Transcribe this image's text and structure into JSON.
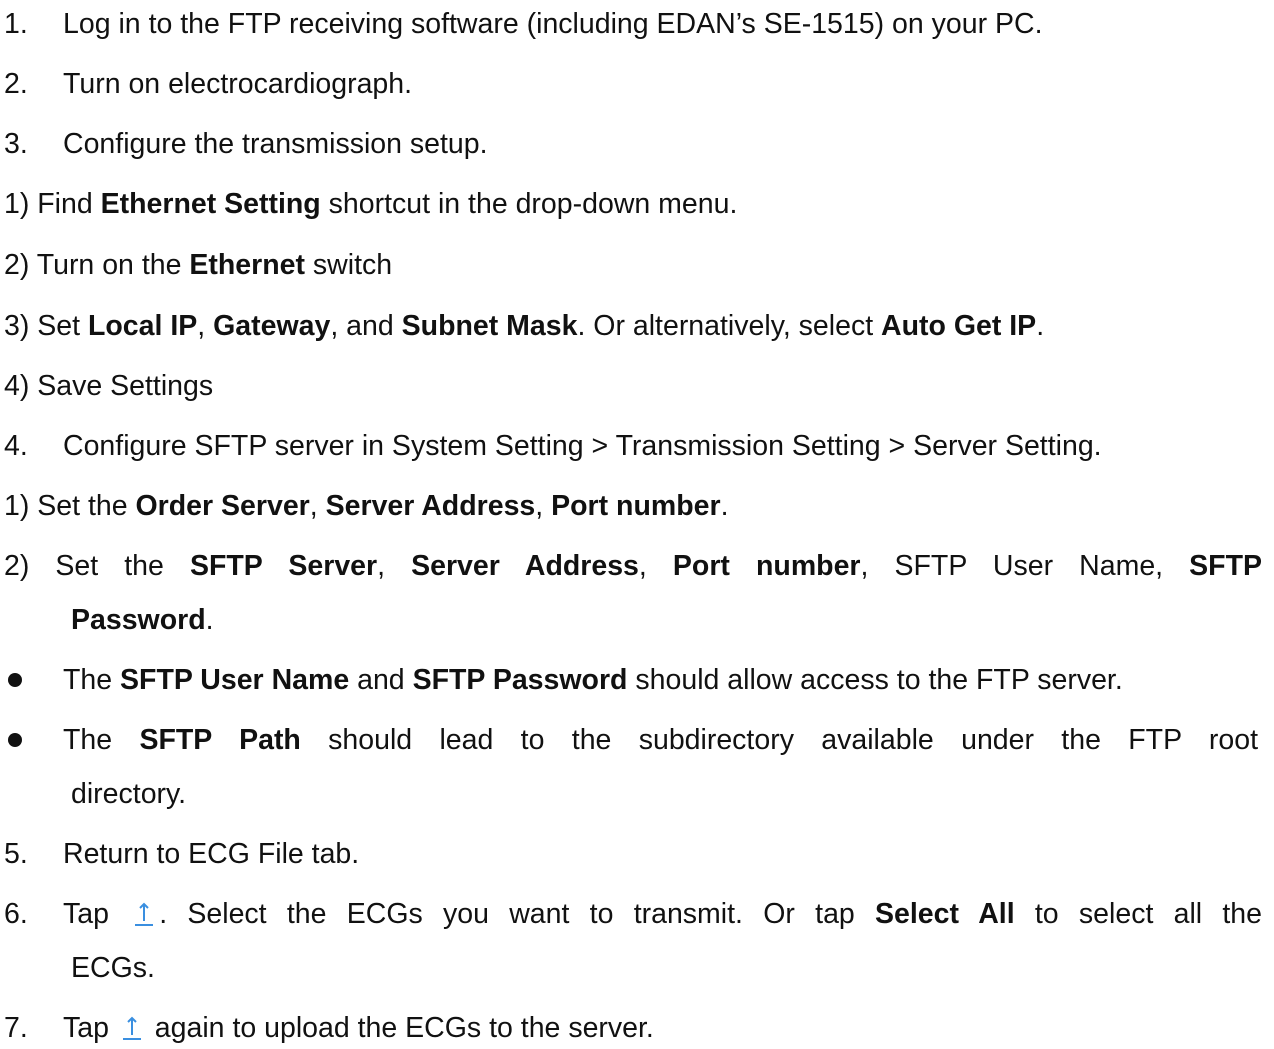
{
  "steps": {
    "s1": {
      "num": "1.",
      "text": "Log in to the FTP receiving software (including EDAN’s SE-1515) on your PC."
    },
    "s2": {
      "num": "2.",
      "text": "Turn on electrocardiograph."
    },
    "s3": {
      "num": "3.",
      "text": "Configure the transmission setup."
    },
    "s3_1": {
      "prefix": "1) Find ",
      "bold": "Ethernet Setting",
      "suffix": " shortcut in the drop-down menu."
    },
    "s3_2": {
      "prefix": "2) Turn on the ",
      "bold": "Ethernet",
      "suffix": " switch"
    },
    "s3_3": {
      "p1": "3) Set ",
      "b1": "Local IP",
      "p2": ", ",
      "b2": "Gateway",
      "p3": ", and ",
      "b3": "Subnet Mask",
      "p4": ". Or alternatively, select ",
      "b4": "Auto Get IP",
      "p5": "."
    },
    "s3_4": {
      "text": "4) Save Settings"
    },
    "s4": {
      "num": "4.",
      "text": "Configure SFTP server in System Setting > Transmission Setting > Server Setting."
    },
    "s4_1": {
      "p1": "1) Set the ",
      "b1": "Order Server",
      "p2": ", ",
      "b2": "Server Address",
      "p3": ", ",
      "b3": "Port number",
      "p4": "."
    },
    "s4_2": {
      "p1": "2) Set the ",
      "b1": "SFTP Server",
      "p2": ", ",
      "b2": "Server Address",
      "p3": ", ",
      "b3": "Port number",
      "p4": ", SFTP User Name, ",
      "b4": "SFTP",
      "b5": "Password",
      "p5": "."
    },
    "bullet1": {
      "p1": "The ",
      "b1": "SFTP User Name",
      "p2": " and ",
      "b2": "SFTP Password",
      "p3": " should allow access to the FTP server."
    },
    "bullet2": {
      "p1": "The ",
      "b1": "SFTP Path",
      "p2": " should lead to the subdirectory available under the FTP root",
      "p3": "directory."
    },
    "s5": {
      "num": "5.",
      "text": "Return to ECG File tab."
    },
    "s6": {
      "num": "6.",
      "p1": "Tap ",
      "p2": ". Select the ECGs you want to transmit. Or tap ",
      "b1": "Select All",
      "p3": " to select all the",
      "p4": "ECGs."
    },
    "s7": {
      "num": "7.",
      "p1": "Tap ",
      "p2": " again to upload the ECGs to the server."
    }
  },
  "icons": {
    "upload": "upload-icon",
    "bullet": "bullet-icon"
  },
  "colors": {
    "text": "#111111",
    "icon": "#3a8fe0"
  }
}
